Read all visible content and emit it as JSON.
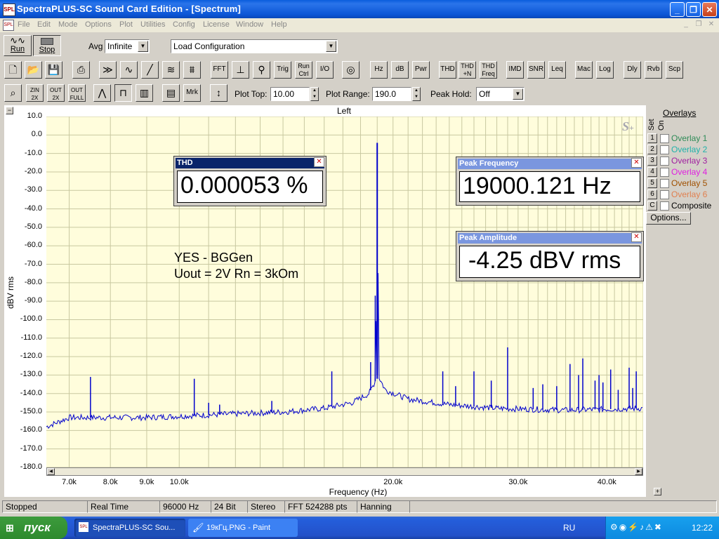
{
  "window": {
    "title": "SpectraPLUS-SC Sound Card Edition - [Spectrum]",
    "icon": "SPL"
  },
  "menu": [
    "File",
    "Edit",
    "Mode",
    "Options",
    "Plot",
    "Utilities",
    "Config",
    "License",
    "Window",
    "Help"
  ],
  "toolbar1": {
    "run": "Run",
    "stop": "Stop",
    "avg_label": "Avg",
    "avg_value": "Infinite",
    "config_value": "Load Configuration"
  },
  "toolbar2": [
    "FFT",
    "Trig",
    "Run Ctrl",
    "I/O",
    "Hz",
    "dB",
    "Pwr",
    "THD",
    "THD +N",
    "THD Freq",
    "IMD",
    "SNR",
    "Leq",
    "Mac",
    "Log",
    "Dly",
    "Rvb",
    "Scp"
  ],
  "toolbar3": {
    "zin": "ZIN 2X",
    "zout": "OUT 2X",
    "zfull": "OUT FULL",
    "mrk": "Mrk",
    "plot_top_label": "Plot Top:",
    "plot_top": "10.00",
    "plot_range_label": "Plot Range:",
    "plot_range": "190.0",
    "peak_hold_label": "Peak Hold:",
    "peak_hold": "Off"
  },
  "chart_data": {
    "type": "line",
    "title": "Left",
    "xlabel": "Frequency (Hz)",
    "ylabel": "dBV rms",
    "x_scale": "log",
    "xlim": [
      6500,
      45000
    ],
    "ylim": [
      -180,
      10
    ],
    "y_ticks": [
      "10.0",
      "0.0",
      "-10.0",
      "-20.0",
      "-30.0",
      "-40.0",
      "-50.0",
      "-60.0",
      "-70.0",
      "-80.0",
      "-90.0",
      "-100.0",
      "-110.0",
      "-120.0",
      "-130.0",
      "-140.0",
      "-150.0",
      "-160.0",
      "-170.0",
      "-180.0"
    ],
    "x_ticks": [
      {
        "v": 7000,
        "t": "7.0k"
      },
      {
        "v": 8000,
        "t": "8.0k"
      },
      {
        "v": 9000,
        "t": "9.0k"
      },
      {
        "v": 10000,
        "t": "10.0k"
      },
      {
        "v": 20000,
        "t": "20.0k"
      },
      {
        "v": 30000,
        "t": "30.0k"
      },
      {
        "v": 40000,
        "t": "40.0k"
      }
    ],
    "grid": true,
    "line_color": "#0000cc",
    "noise_floor": [
      [
        6500,
        -158
      ],
      [
        7000,
        -153
      ],
      [
        9000,
        -153
      ],
      [
        12000,
        -151
      ],
      [
        14000,
        -150
      ],
      [
        16000,
        -148
      ],
      [
        17500,
        -145
      ],
      [
        18500,
        -140
      ],
      [
        18900,
        -133
      ],
      [
        19000,
        -4.25
      ],
      [
        19100,
        -131
      ],
      [
        19500,
        -138
      ],
      [
        21000,
        -143
      ],
      [
        24000,
        -146
      ],
      [
        28000,
        -148
      ],
      [
        35000,
        -149
      ],
      [
        45000,
        -148
      ]
    ],
    "spurs": [
      [
        7500,
        -131
      ],
      [
        10500,
        -132
      ],
      [
        11000,
        -145
      ],
      [
        11400,
        -146
      ],
      [
        13500,
        -144
      ],
      [
        16400,
        -128
      ],
      [
        18600,
        -123
      ],
      [
        18880,
        -87
      ],
      [
        23500,
        -128
      ],
      [
        24500,
        -136
      ],
      [
        26000,
        -128
      ],
      [
        27500,
        -133
      ],
      [
        29000,
        -115
      ],
      [
        31500,
        -137
      ],
      [
        32500,
        -135
      ],
      [
        34000,
        -136
      ],
      [
        35500,
        -124
      ],
      [
        36500,
        -130
      ],
      [
        37000,
        -121
      ],
      [
        38500,
        -133
      ],
      [
        39000,
        -130
      ],
      [
        39500,
        -134
      ],
      [
        40500,
        -127
      ],
      [
        41500,
        -138
      ],
      [
        43000,
        -126
      ],
      [
        43500,
        -137
      ],
      [
        44000,
        -128
      ]
    ]
  },
  "annotation": {
    "line1": "YES - BGGen",
    "line2": "Uout = 2V  Rn = 3kOm"
  },
  "readouts": {
    "thd": {
      "title": "THD",
      "value": "0.000053 %"
    },
    "peak_freq": {
      "title": "Peak Frequency",
      "value": "19000.121 Hz"
    },
    "peak_amp": {
      "title": "Peak Amplitude",
      "value": "-4.25 dBV rms"
    }
  },
  "overlays": {
    "title": "Overlays",
    "set_label": "Set",
    "on_label": "On",
    "items": [
      {
        "n": "1",
        "label": "Overlay 1",
        "color": "#2e8b57"
      },
      {
        "n": "2",
        "label": "Overlay 2",
        "color": "#20b2aa"
      },
      {
        "n": "3",
        "label": "Overlay 3",
        "color": "#a020a0"
      },
      {
        "n": "4",
        "label": "Overlay 4",
        "color": "#e020e0"
      },
      {
        "n": "5",
        "label": "Overlay 5",
        "color": "#a05000"
      },
      {
        "n": "6",
        "label": "Overlay 6",
        "color": "#e08050"
      },
      {
        "n": "C",
        "label": "Composite",
        "color": "#000000"
      }
    ],
    "options": "Options..."
  },
  "status": [
    "Stopped",
    "Real Time",
    "96000 Hz",
    "24 Bit",
    "Stereo",
    "FFT 524288 pts",
    "Hanning"
  ],
  "taskbar": {
    "start": "пуск",
    "tasks": [
      "SpectraPLUS-SC Sou...",
      "19кГц.PNG - Paint"
    ],
    "lang": "RU",
    "clock": "12:22"
  }
}
